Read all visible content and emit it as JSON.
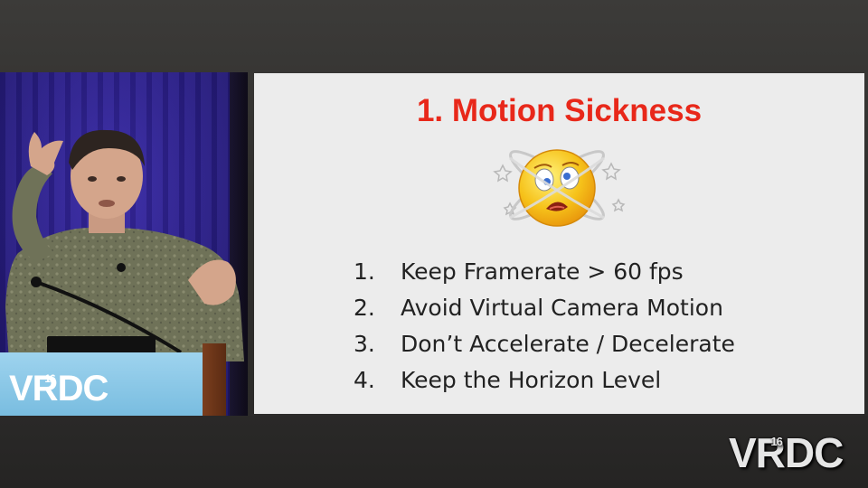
{
  "slide": {
    "title": "1. Motion Sickness",
    "items": [
      {
        "number": "1.",
        "text": "Keep Framerate > 60 fps"
      },
      {
        "number": "2.",
        "text": "Avoid Virtual Camera Motion"
      },
      {
        "number": "3.",
        "text": "Don’t Accelerate / Decelerate"
      },
      {
        "number": "4.",
        "text": "Keep the Horizon Level"
      }
    ],
    "title_color": "#e8281a",
    "background_color": "#ececec"
  },
  "podium": {
    "logo_text": "VRDC",
    "logo_badge": "16",
    "color": "#8fcbe9"
  },
  "watermark": {
    "logo_text": "VRDC",
    "logo_badge": "16"
  },
  "icons": {
    "slide_emoji": "dizzy-face-icon"
  }
}
